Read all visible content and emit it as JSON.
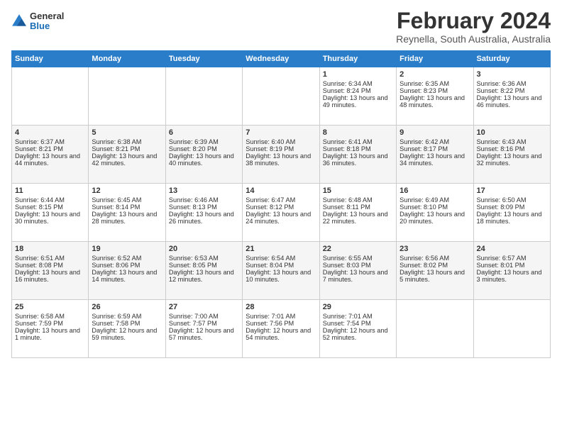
{
  "header": {
    "logo_general": "General",
    "logo_blue": "Blue",
    "main_title": "February 2024",
    "subtitle": "Reynella, South Australia, Australia"
  },
  "weekdays": [
    "Sunday",
    "Monday",
    "Tuesday",
    "Wednesday",
    "Thursday",
    "Friday",
    "Saturday"
  ],
  "weeks": [
    [
      {
        "day": "",
        "empty": true
      },
      {
        "day": "",
        "empty": true
      },
      {
        "day": "",
        "empty": true
      },
      {
        "day": "",
        "empty": true
      },
      {
        "day": "1",
        "sunrise": "6:34 AM",
        "sunset": "8:24 PM",
        "daylight": "13 hours and 49 minutes."
      },
      {
        "day": "2",
        "sunrise": "6:35 AM",
        "sunset": "8:23 PM",
        "daylight": "13 hours and 48 minutes."
      },
      {
        "day": "3",
        "sunrise": "6:36 AM",
        "sunset": "8:22 PM",
        "daylight": "13 hours and 46 minutes."
      }
    ],
    [
      {
        "day": "4",
        "sunrise": "6:37 AM",
        "sunset": "8:21 PM",
        "daylight": "13 hours and 44 minutes."
      },
      {
        "day": "5",
        "sunrise": "6:38 AM",
        "sunset": "8:21 PM",
        "daylight": "13 hours and 42 minutes."
      },
      {
        "day": "6",
        "sunrise": "6:39 AM",
        "sunset": "8:20 PM",
        "daylight": "13 hours and 40 minutes."
      },
      {
        "day": "7",
        "sunrise": "6:40 AM",
        "sunset": "8:19 PM",
        "daylight": "13 hours and 38 minutes."
      },
      {
        "day": "8",
        "sunrise": "6:41 AM",
        "sunset": "8:18 PM",
        "daylight": "13 hours and 36 minutes."
      },
      {
        "day": "9",
        "sunrise": "6:42 AM",
        "sunset": "8:17 PM",
        "daylight": "13 hours and 34 minutes."
      },
      {
        "day": "10",
        "sunrise": "6:43 AM",
        "sunset": "8:16 PM",
        "daylight": "13 hours and 32 minutes."
      }
    ],
    [
      {
        "day": "11",
        "sunrise": "6:44 AM",
        "sunset": "8:15 PM",
        "daylight": "13 hours and 30 minutes."
      },
      {
        "day": "12",
        "sunrise": "6:45 AM",
        "sunset": "8:14 PM",
        "daylight": "13 hours and 28 minutes."
      },
      {
        "day": "13",
        "sunrise": "6:46 AM",
        "sunset": "8:13 PM",
        "daylight": "13 hours and 26 minutes."
      },
      {
        "day": "14",
        "sunrise": "6:47 AM",
        "sunset": "8:12 PM",
        "daylight": "13 hours and 24 minutes."
      },
      {
        "day": "15",
        "sunrise": "6:48 AM",
        "sunset": "8:11 PM",
        "daylight": "13 hours and 22 minutes."
      },
      {
        "day": "16",
        "sunrise": "6:49 AM",
        "sunset": "8:10 PM",
        "daylight": "13 hours and 20 minutes."
      },
      {
        "day": "17",
        "sunrise": "6:50 AM",
        "sunset": "8:09 PM",
        "daylight": "13 hours and 18 minutes."
      }
    ],
    [
      {
        "day": "18",
        "sunrise": "6:51 AM",
        "sunset": "8:08 PM",
        "daylight": "13 hours and 16 minutes."
      },
      {
        "day": "19",
        "sunrise": "6:52 AM",
        "sunset": "8:06 PM",
        "daylight": "13 hours and 14 minutes."
      },
      {
        "day": "20",
        "sunrise": "6:53 AM",
        "sunset": "8:05 PM",
        "daylight": "13 hours and 12 minutes."
      },
      {
        "day": "21",
        "sunrise": "6:54 AM",
        "sunset": "8:04 PM",
        "daylight": "13 hours and 10 minutes."
      },
      {
        "day": "22",
        "sunrise": "6:55 AM",
        "sunset": "8:03 PM",
        "daylight": "13 hours and 7 minutes."
      },
      {
        "day": "23",
        "sunrise": "6:56 AM",
        "sunset": "8:02 PM",
        "daylight": "13 hours and 5 minutes."
      },
      {
        "day": "24",
        "sunrise": "6:57 AM",
        "sunset": "8:01 PM",
        "daylight": "13 hours and 3 minutes."
      }
    ],
    [
      {
        "day": "25",
        "sunrise": "6:58 AM",
        "sunset": "7:59 PM",
        "daylight": "13 hours and 1 minute."
      },
      {
        "day": "26",
        "sunrise": "6:59 AM",
        "sunset": "7:58 PM",
        "daylight": "12 hours and 59 minutes."
      },
      {
        "day": "27",
        "sunrise": "7:00 AM",
        "sunset": "7:57 PM",
        "daylight": "12 hours and 57 minutes."
      },
      {
        "day": "28",
        "sunrise": "7:01 AM",
        "sunset": "7:56 PM",
        "daylight": "12 hours and 54 minutes."
      },
      {
        "day": "29",
        "sunrise": "7:01 AM",
        "sunset": "7:54 PM",
        "daylight": "12 hours and 52 minutes."
      },
      {
        "day": "",
        "empty": true
      },
      {
        "day": "",
        "empty": true
      }
    ]
  ]
}
